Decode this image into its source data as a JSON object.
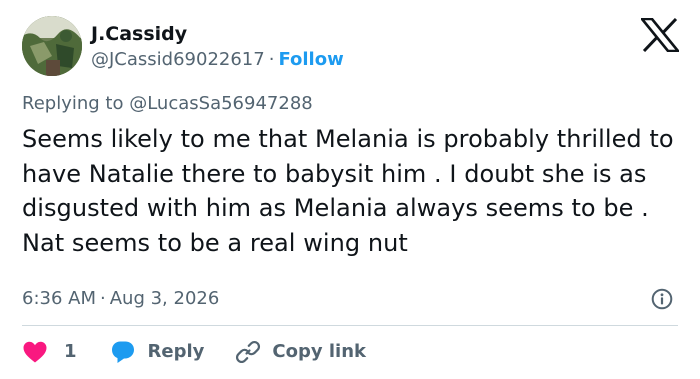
{
  "author": {
    "display_name": "J.Cassidy",
    "handle": "@JCassid69022617",
    "separator": "·",
    "follow_label": "Follow",
    "avatar_icon": "profile-photo-icon"
  },
  "brand": {
    "logo_icon": "x-logo-icon"
  },
  "reply_context": {
    "prefix": "Replying to",
    "mention": "@LucasSa56947288"
  },
  "tweet": {
    "text": "Seems likely to me that Melania is probably thrilled to have Natalie there to babysit him . I doubt she is as disgusted with him as Melania always seems to be . Nat seems to be a real wing nut"
  },
  "meta": {
    "time": "6:36 AM",
    "separator": "·",
    "date": "Aug 3, 2026",
    "info_icon": "info-icon"
  },
  "actions": {
    "like": {
      "icon": "heart-icon",
      "count": "1"
    },
    "reply": {
      "icon": "reply-bubble-icon",
      "label": "Reply"
    },
    "copy": {
      "icon": "link-icon",
      "label": "Copy link"
    }
  },
  "colors": {
    "accent": "#1d9bf0",
    "heart": "#f91880",
    "text_primary": "#0f1419",
    "text_secondary": "#536471",
    "divider": "#cfd9de"
  }
}
